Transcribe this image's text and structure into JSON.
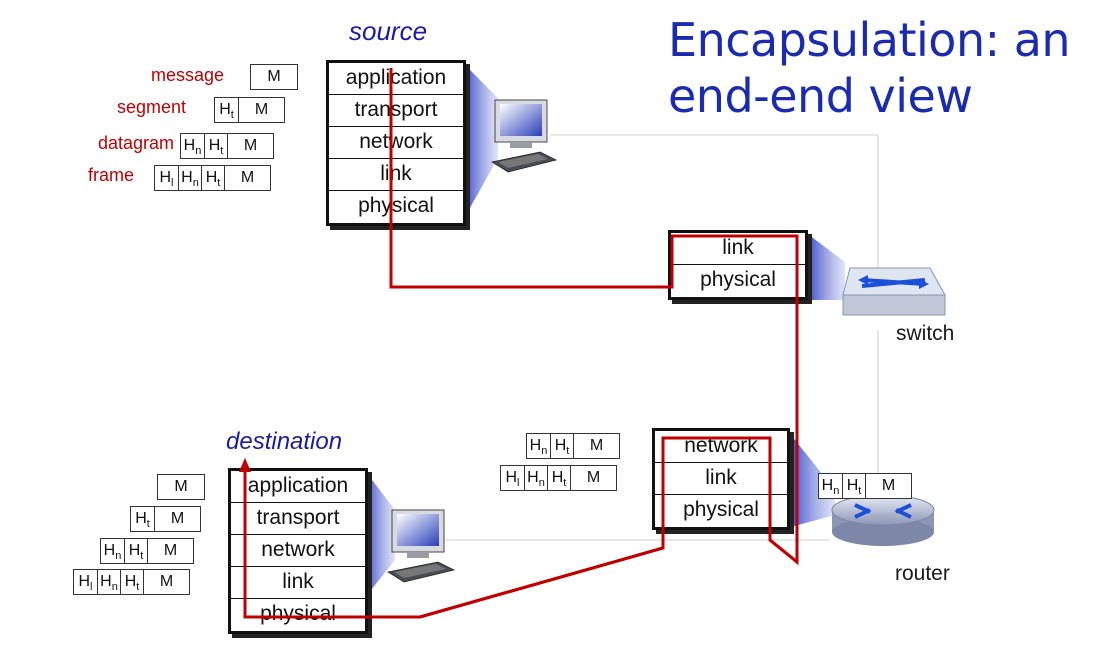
{
  "title": "Encapsulation: an end-end view",
  "source_label": "source",
  "destination_label": "destination",
  "switch_label": "switch",
  "router_label": "router",
  "header_labels": {
    "message": "message",
    "segment": "segment",
    "datagram": "datagram",
    "frame": "frame"
  },
  "layers": {
    "application": "application",
    "transport": "transport",
    "network": "network",
    "link": "link",
    "physical": "physical"
  },
  "packet": {
    "M": "M",
    "H": "H",
    "t": "t",
    "n": "n",
    "l": "l"
  },
  "colors": {
    "title": "#1a2bb0",
    "path": "#c00000",
    "header_labels": "#c00000",
    "stack_border": "#111111"
  }
}
